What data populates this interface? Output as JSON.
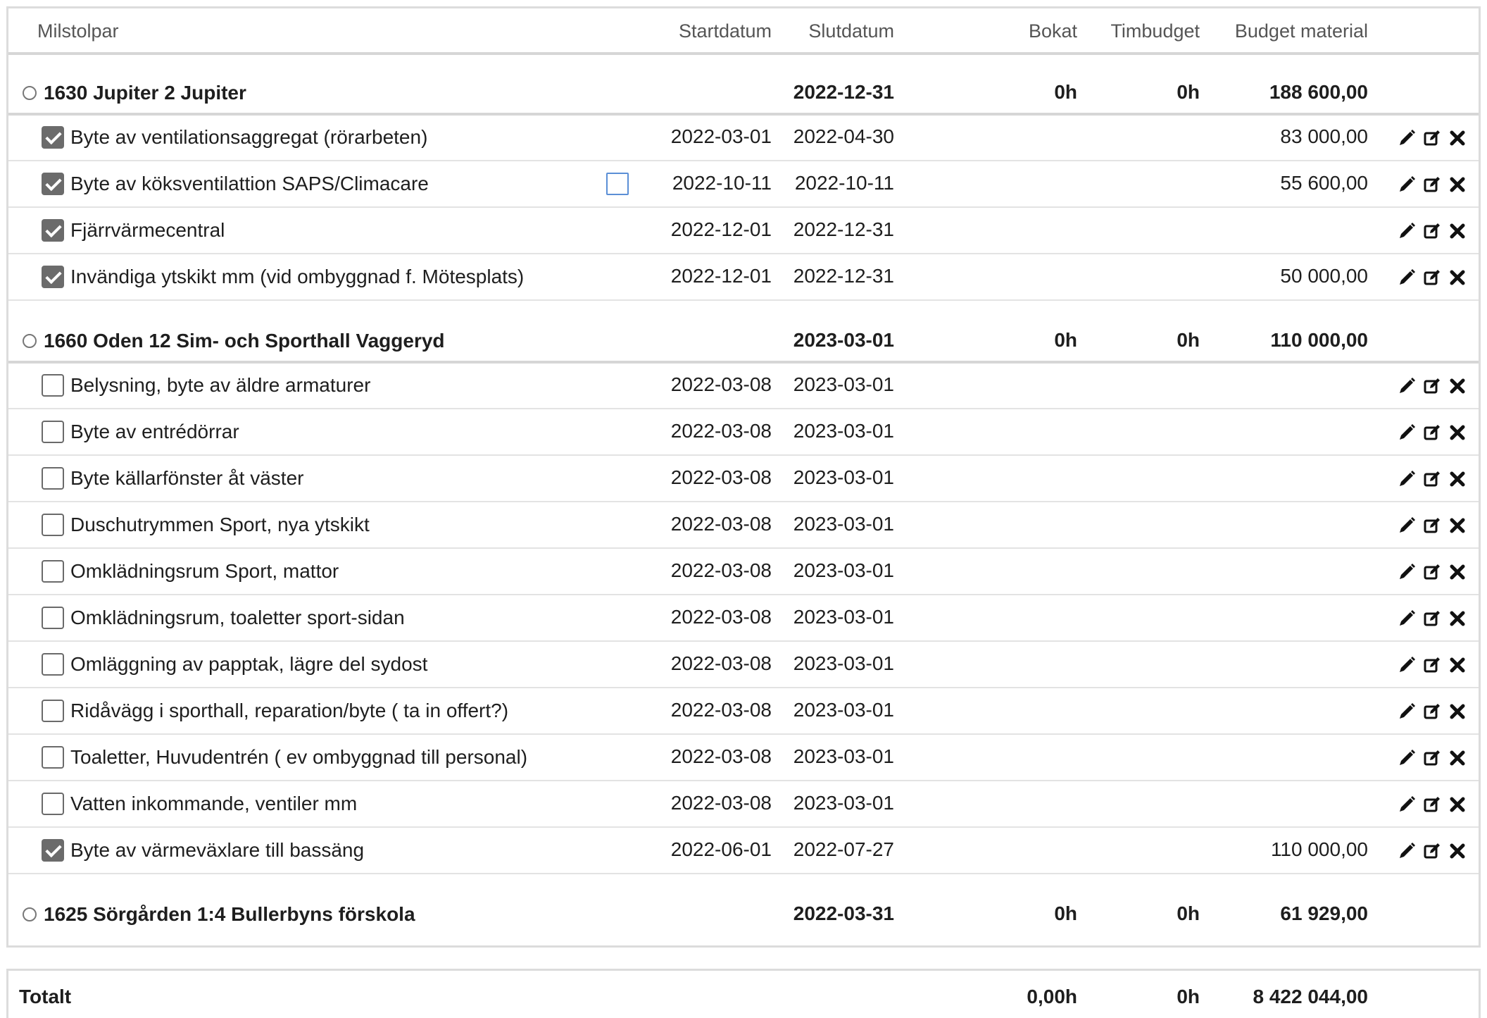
{
  "columns": {
    "milestone": "Milstolpar",
    "start": "Startdatum",
    "end": "Slutdatum",
    "booked": "Bokat",
    "hours_budget": "Timbudget",
    "material_budget": "Budget material"
  },
  "groups": [
    {
      "title": "1630 Jupiter 2 Jupiter",
      "end": "2022-12-31",
      "booked": "0h",
      "hours_budget": "0h",
      "material_budget": "188 600,00",
      "items": [
        {
          "label": "Byte av ventilationsaggregat (rörarbeten)",
          "checked": true,
          "start": "2022-03-01",
          "end": "2022-04-30",
          "material_budget": "83 000,00"
        },
        {
          "label": "Byte av köksventilattion SAPS/Climacare",
          "checked": true,
          "extra_checkbox": true,
          "start": "2022-10-11",
          "end": "2022-10-11",
          "material_budget": "55 600,00"
        },
        {
          "label": "Fjärrvärmecentral",
          "checked": true,
          "start": "2022-12-01",
          "end": "2022-12-31",
          "material_budget": ""
        },
        {
          "label": "Invändiga ytskikt mm (vid ombyggnad f. Mötesplats)",
          "checked": true,
          "start": "2022-12-01",
          "end": "2022-12-31",
          "material_budget": "50 000,00"
        }
      ]
    },
    {
      "title": "1660 Oden 12 Sim- och Sporthall Vaggeryd",
      "end": "2023-03-01",
      "booked": "0h",
      "hours_budget": "0h",
      "material_budget": "110 000,00",
      "items": [
        {
          "label": "Belysning, byte av äldre armaturer",
          "checked": false,
          "start": "2022-03-08",
          "end": "2023-03-01",
          "material_budget": ""
        },
        {
          "label": "Byte av entrédörrar",
          "checked": false,
          "start": "2022-03-08",
          "end": "2023-03-01",
          "material_budget": ""
        },
        {
          "label": "Byte källarfönster åt väster",
          "checked": false,
          "start": "2022-03-08",
          "end": "2023-03-01",
          "material_budget": ""
        },
        {
          "label": "Duschutrymmen Sport, nya ytskikt",
          "checked": false,
          "start": "2022-03-08",
          "end": "2023-03-01",
          "material_budget": ""
        },
        {
          "label": "Omklädningsrum Sport, mattor",
          "checked": false,
          "start": "2022-03-08",
          "end": "2023-03-01",
          "material_budget": ""
        },
        {
          "label": "Omklädningsrum, toaletter sport-sidan",
          "checked": false,
          "start": "2022-03-08",
          "end": "2023-03-01",
          "material_budget": ""
        },
        {
          "label": "Omläggning av papptak, lägre del sydost",
          "checked": false,
          "start": "2022-03-08",
          "end": "2023-03-01",
          "material_budget": ""
        },
        {
          "label": "Ridåvägg i sporthall, reparation/byte ( ta in offert?)",
          "checked": false,
          "start": "2022-03-08",
          "end": "2023-03-01",
          "material_budget": ""
        },
        {
          "label": "Toaletter, Huvudentrén ( ev ombyggnad till personal)",
          "checked": false,
          "start": "2022-03-08",
          "end": "2023-03-01",
          "material_budget": ""
        },
        {
          "label": "Vatten inkommande, ventiler mm",
          "checked": false,
          "start": "2022-03-08",
          "end": "2023-03-01",
          "material_budget": ""
        },
        {
          "label": "Byte av värmeväxlare till bassäng",
          "checked": true,
          "start": "2022-06-01",
          "end": "2022-07-27",
          "material_budget": "110 000,00"
        }
      ]
    },
    {
      "title": "1625 Sörgården 1:4 Bullerbyns förskola",
      "end": "2022-03-31",
      "booked": "0h",
      "hours_budget": "0h",
      "material_budget": "61 929,00",
      "items": []
    }
  ],
  "total": {
    "label": "Totalt",
    "booked": "0,00h",
    "hours_budget": "0h",
    "material_budget": "8 422 044,00"
  },
  "icons": [
    "pencil-icon",
    "edit-box-icon",
    "close-icon"
  ]
}
